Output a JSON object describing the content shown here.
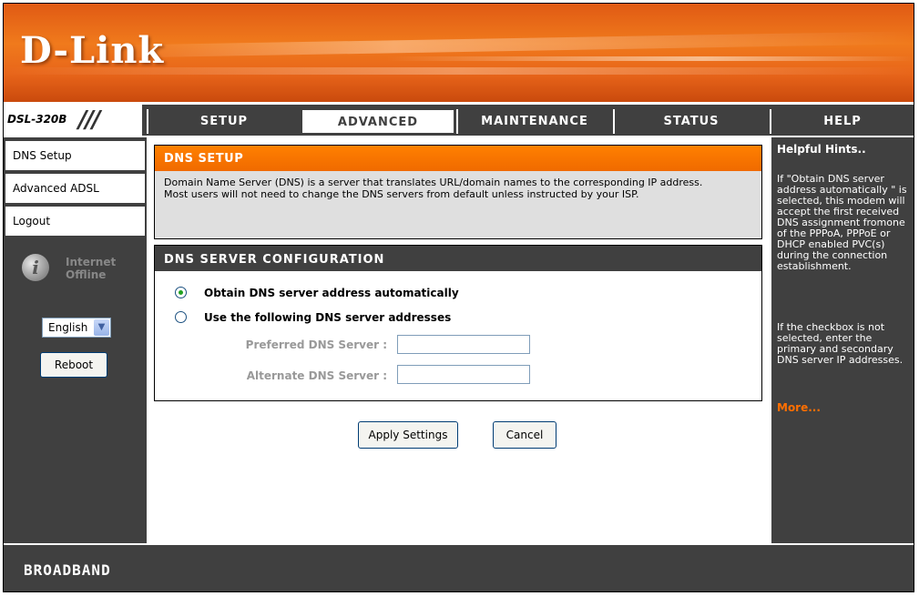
{
  "brand": {
    "logo": "D-Link",
    "model": "DSL-320B",
    "footer": "BROADBAND"
  },
  "tabs": [
    {
      "label": "SETUP",
      "active": false
    },
    {
      "label": "ADVANCED",
      "active": true
    },
    {
      "label": "MAINTENANCE",
      "active": false
    },
    {
      "label": "STATUS",
      "active": false
    },
    {
      "label": "HELP",
      "active": false
    }
  ],
  "sidebar": {
    "items": [
      {
        "label": "DNS Setup"
      },
      {
        "label": "Advanced ADSL"
      },
      {
        "label": "Logout"
      }
    ],
    "status_line1": "Internet",
    "status_line2": "Offline",
    "language": "English",
    "reboot_label": "Reboot"
  },
  "dns_setup": {
    "title": "DNS SETUP",
    "description_line1": "Domain Name Server (DNS) is a server that translates URL/domain names to the corresponding IP address.",
    "description_line2": "Most users will not need to change the DNS servers from default unless instructed by your ISP."
  },
  "dns_config": {
    "title": "DNS SERVER CONFIGURATION",
    "option_auto": "Obtain DNS server address automatically",
    "option_manual": "Use the following DNS server addresses",
    "selected": "auto",
    "preferred_label": "Preferred DNS Server :",
    "preferred_value": "",
    "alternate_label": "Alternate DNS Server :",
    "alternate_value": ""
  },
  "actions": {
    "apply_label": "Apply Settings",
    "cancel_label": "Cancel"
  },
  "help": {
    "title": "Helpful Hints..",
    "para1": "If \"Obtain DNS server address automatically \" is selected, this modem will accept the first received DNS assignment fromone of the PPPoA, PPPoE or DHCP enabled PVC(s) during the connection establishment.",
    "para2": "If the checkbox is not selected, enter the primary and secondary DNS server IP addresses.",
    "more": "More..."
  },
  "colors": {
    "accent": "#ff6f00",
    "dark": "#404040"
  }
}
